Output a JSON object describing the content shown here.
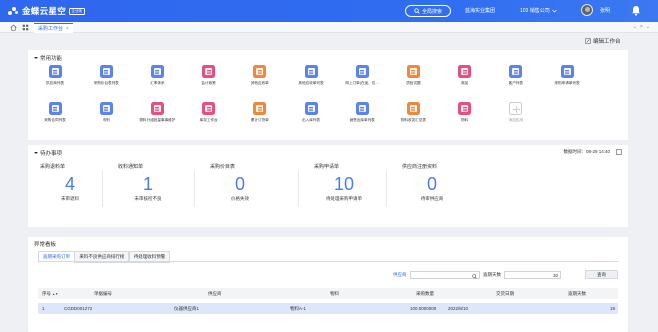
{
  "brand": {
    "name": "金蝶云星空",
    "badge": "企业版"
  },
  "header": {
    "search_label": "全局搜索",
    "org": "蓝海实业集团",
    "company": "103 销售公司",
    "user": "张明"
  },
  "tabs": {
    "active": "采购工作台"
  },
  "edit_label": "编辑工作台",
  "common": {
    "title": "常用功能",
    "items": [
      {
        "label": "供应商列表",
        "color": "#5b84e8"
      },
      {
        "label": "采购价目表列表",
        "color": "#5b84e8"
      },
      {
        "label": "汇率体系",
        "color": "#5b84e8"
      },
      {
        "label": "会计政策",
        "color": "#e6507e"
      },
      {
        "label": "其他应收单",
        "color": "#f0883c"
      },
      {
        "label": "其他应收单列表",
        "color": "#5b84e8"
      },
      {
        "label": "网上订单(在途、仅…",
        "color": "#5b84e8"
      },
      {
        "label": "质检试题",
        "color": "#f0883c"
      },
      {
        "label": "商品",
        "color": "#e6507e"
      },
      {
        "label": "客户列表",
        "color": "#5b84e8"
      },
      {
        "label": "采购申请单列表",
        "color": "#5b84e8"
      },
      {
        "label": "采购合同列表",
        "color": "#5b84e8"
      },
      {
        "label": "币别",
        "color": "#5b84e8"
      },
      {
        "label": "物料分组批量事事维护",
        "color": "#e6507e"
      },
      {
        "label": "库存工作台",
        "color": "#e6507e"
      },
      {
        "label": "累计订货单",
        "color": "#f0883c"
      },
      {
        "label": "出入库列表",
        "color": "#5b84e8"
      },
      {
        "label": "销售出库单列表",
        "color": "#5b84e8"
      },
      {
        "label": "物料收发汇总表",
        "color": "#f0883c"
      },
      {
        "label": "物料",
        "color": "#e6507e"
      },
      {
        "label": "添加应用",
        "color": "#ffffff"
      }
    ]
  },
  "todo": {
    "title": "待办事项",
    "time": "数据时间：08-29 14:40",
    "items": [
      {
        "title": "采购退料单",
        "count": "4",
        "sub": "未审退料"
      },
      {
        "title": "收料通知单",
        "count": "1",
        "sub": "未审核检不良"
      },
      {
        "title": "采购价目表",
        "count": "0",
        "sub": "价格失效"
      },
      {
        "title": "采购申请单",
        "count": "10",
        "sub": "待处理采购申请单"
      },
      {
        "title": "供应商注册资料",
        "count": "0",
        "sub": "待审供应商"
      }
    ]
  },
  "exception": {
    "title": "异常看板",
    "tabs": [
      "逾期采购订单",
      "来料不良供应商排行榜",
      "待处理收料预警"
    ],
    "filter": {
      "supplier_label": "供应商",
      "days_label": "逾期天数",
      "days_value": "30",
      "query_label": "查询"
    },
    "columns": [
      "序号",
      "单据编号",
      "供应商",
      "物料",
      "采购数量",
      "交货日期",
      "逾期天数"
    ],
    "rows": [
      {
        "idx": "1",
        "bill": "CGDD001272",
        "supplier": "仪器供应商1",
        "material": "物料A-1",
        "qty": "100.0000000",
        "date": "2022/8/10",
        "days": "19"
      }
    ]
  }
}
